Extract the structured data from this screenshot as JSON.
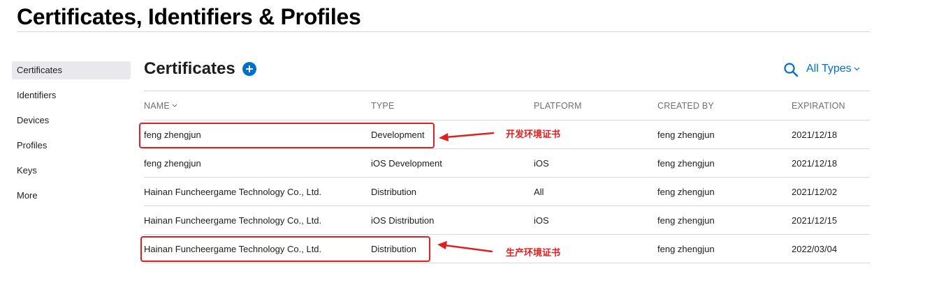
{
  "header": {
    "title": "Certificates, Identifiers & Profiles"
  },
  "sidebar": {
    "items": [
      {
        "label": "Certificates",
        "active": true
      },
      {
        "label": "Identifiers"
      },
      {
        "label": "Devices"
      },
      {
        "label": "Profiles"
      },
      {
        "label": "Keys"
      },
      {
        "label": "More"
      }
    ]
  },
  "main": {
    "title": "Certificates",
    "add_icon": "plus-circle-icon",
    "search_icon": "search-icon",
    "filter": {
      "label": "All Types"
    },
    "columns": {
      "name": "NAME",
      "type": "TYPE",
      "platform": "PLATFORM",
      "created_by": "CREATED BY",
      "expiration": "EXPIRATION"
    },
    "rows": [
      {
        "name": "feng zhengjun",
        "type": "Development",
        "platform": "",
        "created_by": "feng zhengjun",
        "expiration": "2021/12/18"
      },
      {
        "name": "feng zhengjun",
        "type": "iOS Development",
        "platform": "iOS",
        "created_by": "feng zhengjun",
        "expiration": "2021/12/18"
      },
      {
        "name": "Hainan Funcheergame Technology Co., Ltd.",
        "type": "Distribution",
        "platform": "All",
        "created_by": "feng zhengjun",
        "expiration": "2021/12/02"
      },
      {
        "name": "Hainan Funcheergame Technology Co., Ltd.",
        "type": "iOS Distribution",
        "platform": "iOS",
        "created_by": "feng zhengjun",
        "expiration": "2021/12/15"
      },
      {
        "name": "Hainan Funcheergame Technology Co., Ltd.",
        "type": "Distribution",
        "platform": "",
        "created_by": "feng zhengjun",
        "expiration": "2022/03/04"
      }
    ]
  },
  "annotations": {
    "dev": "开发环境证书",
    "prod": "生产环境证书",
    "color": "#e02020"
  },
  "colors": {
    "accent": "#0070c9"
  }
}
